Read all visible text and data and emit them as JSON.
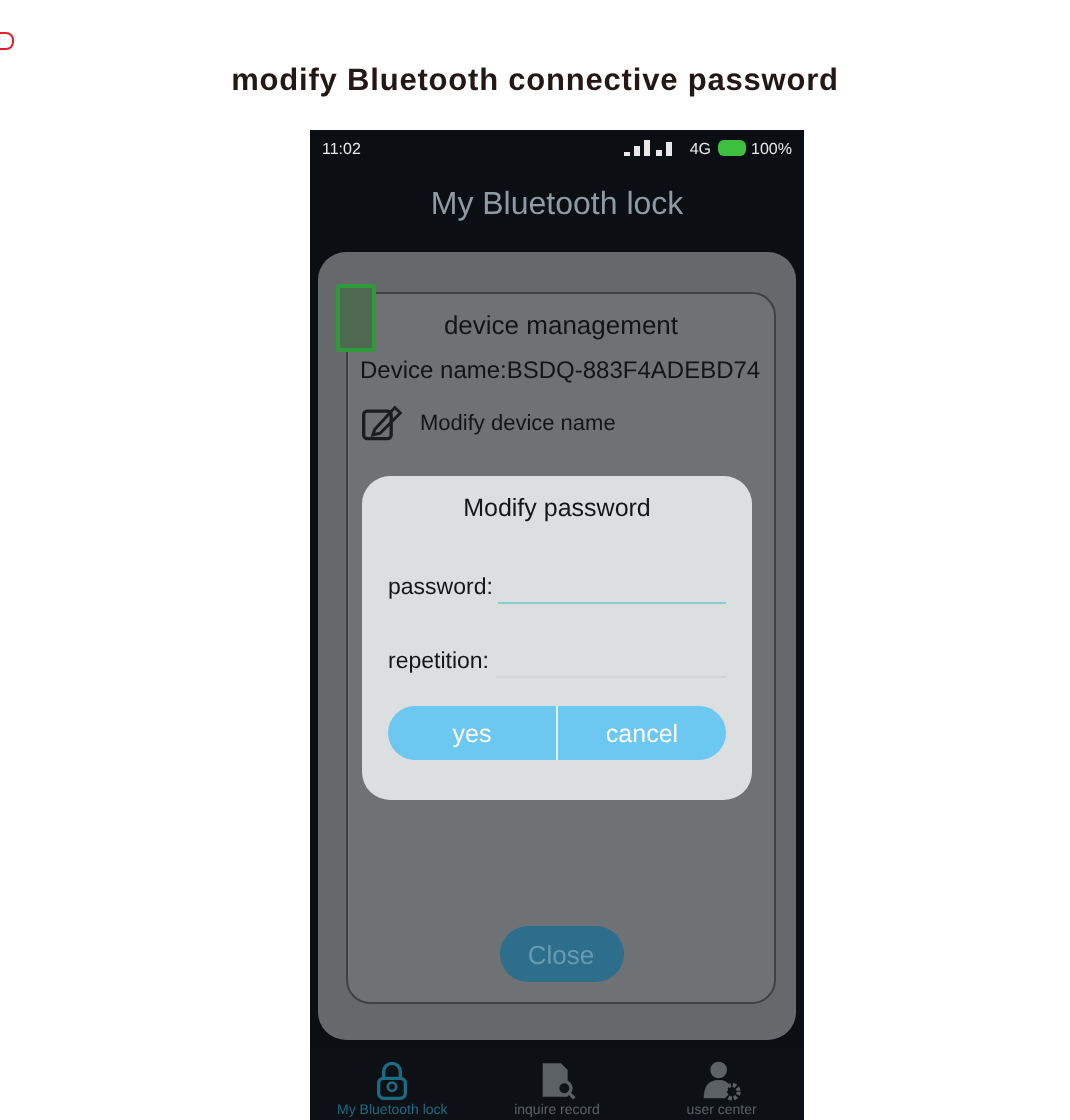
{
  "page_title": "modify Bluetooth connective password",
  "status_bar": {
    "time": "11:02",
    "network": "4G",
    "battery": "100%"
  },
  "app_title": "My Bluetooth lock",
  "panel": {
    "title": "device management",
    "device_name": "Device name:BSDQ-883F4ADEBD74",
    "items": [
      {
        "kind": "edit",
        "label": "Modify device name"
      }
    ],
    "close": "Close"
  },
  "dialog": {
    "title": "Modify password",
    "fields": [
      {
        "label": "password:",
        "focused": true
      },
      {
        "label": "repetition:",
        "focused": false
      }
    ],
    "buttons": [
      "yes",
      "cancel"
    ]
  },
  "tabs": [
    {
      "kind": "lock",
      "label": "My Bluetooth lock",
      "selected": true
    },
    {
      "kind": "record",
      "label": "inquire record",
      "selected": false
    },
    {
      "kind": "user",
      "label": "user center",
      "selected": false
    }
  ]
}
